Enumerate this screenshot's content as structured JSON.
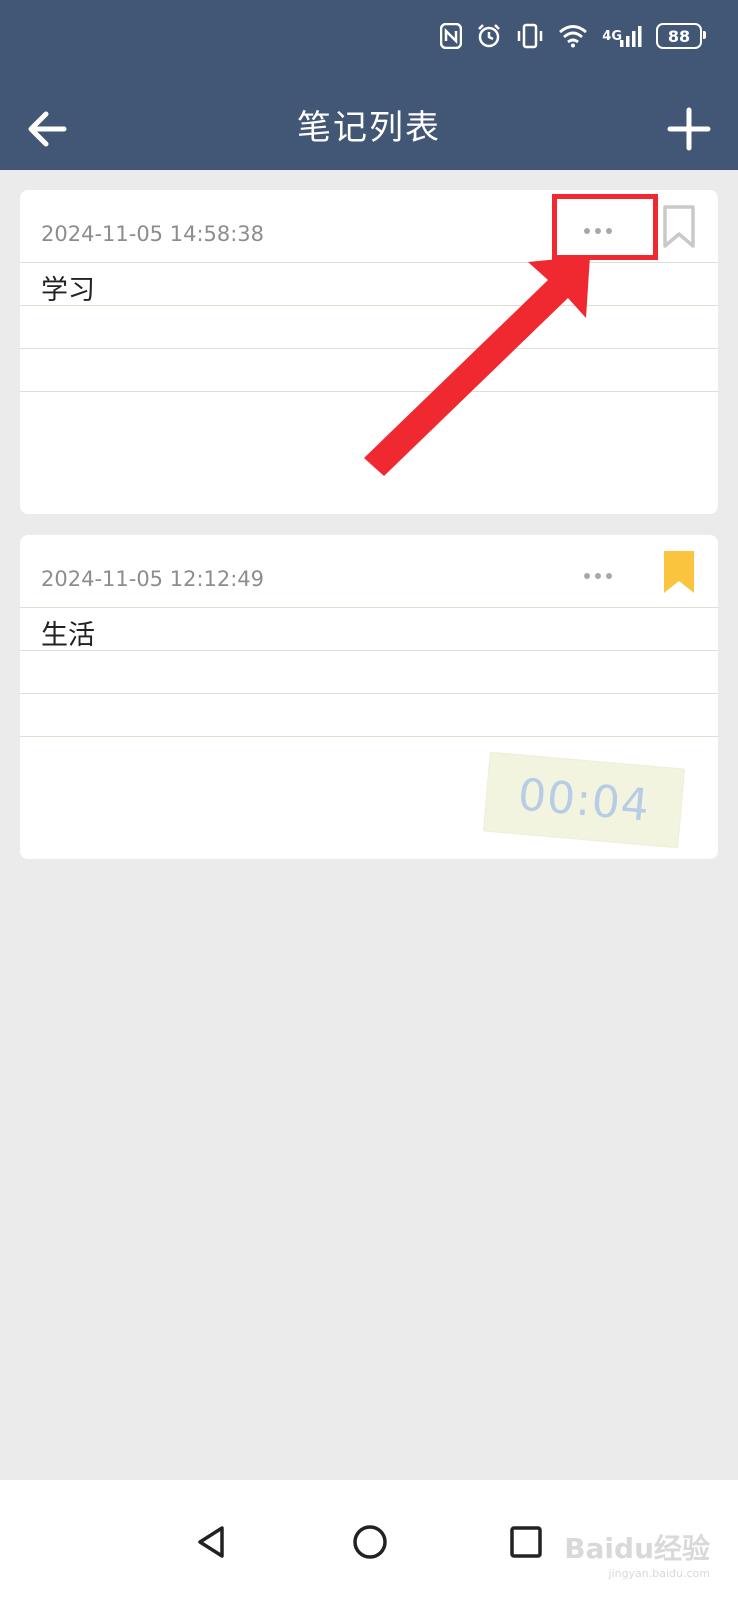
{
  "status_bar": {
    "network_label": "4G",
    "battery": "88",
    "icons": [
      "nfc-icon",
      "alarm-icon",
      "vibrate-icon",
      "wifi-icon",
      "signal-icon",
      "battery-icon"
    ]
  },
  "header": {
    "title": "笔记列表",
    "back_icon": "arrow-left-icon",
    "add_icon": "plus-icon",
    "background": "#425675"
  },
  "notes": [
    {
      "date": "2024-11-05 14:58:38",
      "title": "学习",
      "bookmarked": false
    },
    {
      "date": "2024-11-05 12:12:49",
      "title": "生活",
      "bookmarked": true
    }
  ],
  "sticker": {
    "text": "00:04"
  },
  "annotation": {
    "color": "#f0282f"
  },
  "nav": {
    "icons": [
      "triangle-back-icon",
      "circle-home-icon",
      "square-recent-icon"
    ]
  },
  "watermark": {
    "brand": "Baidu经验",
    "url": "jingyan.baidu.com"
  },
  "colors": {
    "bookmark_active": "#fbc43f",
    "page_bg": "#ebebeb"
  }
}
